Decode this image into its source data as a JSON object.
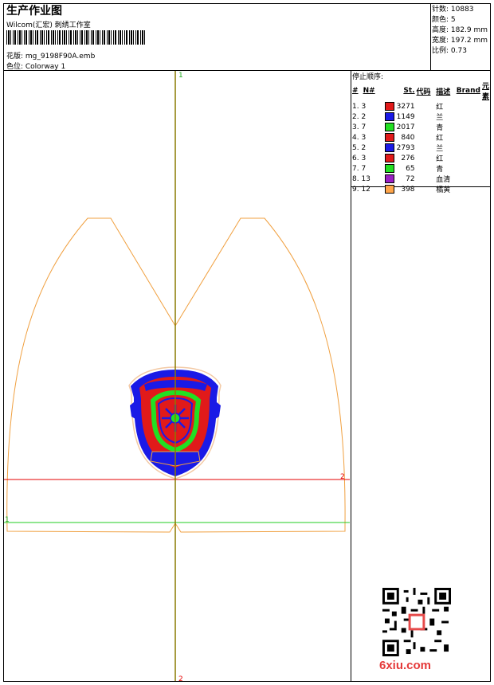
{
  "header": {
    "title": "生产作业图",
    "company": "Wilcom(汇宏) 刺绣工作室",
    "design_label": "花版: mg_9198F90A.emb",
    "colorway_label": "色位: Colorway 1"
  },
  "stats": {
    "stitches": "针数: 10883",
    "colors": "颜色: 5",
    "height": "高度: 182.9 mm",
    "width": "宽度: 197.2 mm",
    "scale": "比例: 0.73"
  },
  "sequence": {
    "title": "停止顺序:",
    "headers": [
      "#",
      "N#",
      "",
      "St.",
      "代码",
      "描述",
      "Brand",
      "元素"
    ],
    "rows": [
      {
        "idx": "1. 3",
        "color": "#e11a1a",
        "st": "3271",
        "desc": "红"
      },
      {
        "idx": "2. 2",
        "color": "#1a1ae6",
        "st": "1149",
        "desc": "兰"
      },
      {
        "idx": "3. 7",
        "color": "#22e022",
        "st": "2017",
        "desc": "青"
      },
      {
        "idx": "4. 3",
        "color": "#e11a1a",
        "st": "840",
        "desc": "红"
      },
      {
        "idx": "5. 2",
        "color": "#1a1ae6",
        "st": "2793",
        "desc": "兰"
      },
      {
        "idx": "6. 3",
        "color": "#e11a1a",
        "st": "276",
        "desc": "红"
      },
      {
        "idx": "7. 7",
        "color": "#22e022",
        "st": "65",
        "desc": "青"
      },
      {
        "idx": "8. 13",
        "color": "#9b1fc4",
        "st": "72",
        "desc": "血清"
      },
      {
        "idx": "9. 12",
        "color": "#ffa54a",
        "st": "398",
        "desc": "橘黄"
      }
    ]
  },
  "markers": {
    "top": "1",
    "bottom": "2",
    "right": "2",
    "left": "1"
  },
  "watermark": "6xiu.com",
  "colors": {
    "outline": "#f0a040",
    "axis_v": "#8a7a00",
    "line_red": "#e60000",
    "line_green": "#22cc22"
  }
}
